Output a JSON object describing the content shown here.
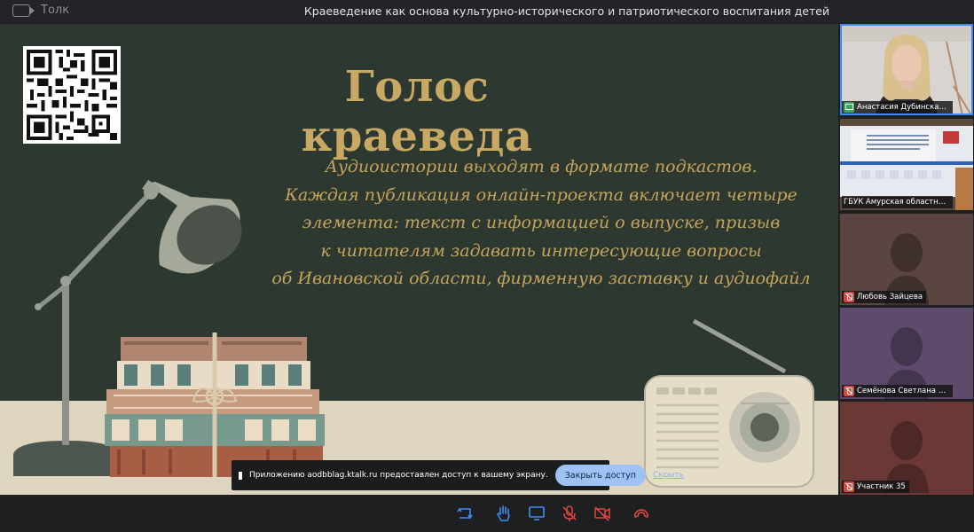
{
  "app": {
    "name": "Толк",
    "meeting_title": "Краеведение как основа культурно-исторического и патриотического воспитания детей"
  },
  "slide": {
    "title": "Голос краеведа",
    "body_lines": [
      "Аудиоистории выходят в формате подкастов.",
      "Каждая публикация онлайн-проекта включает четыре",
      "элемента: текст с информацией о выпуске, призыв",
      "к читателям задавать интересующие вопросы",
      "об Ивановской области, фирменную заставку и аудиофайл"
    ],
    "colors": {
      "background": "#2c3830",
      "title": "#c8a964",
      "floor": "#ddd5bf"
    }
  },
  "screen_share_notice": {
    "text": "Приложению aodbblag.ktalk.ru предоставлен доступ к вашему экрану.",
    "close_access_label": "Закрыть доступ",
    "hide_label": "Скрыть"
  },
  "participants": [
    {
      "name": "Анастасия Дубинская...",
      "indicator": "screen-share-icon",
      "speaking": true
    },
    {
      "name": "ГБУК Амурская областная...",
      "indicator": "none",
      "speaking": false
    },
    {
      "name": "Любовь Зайцева",
      "indicator": "mic-off-icon",
      "speaking": false
    },
    {
      "name": "Семёнова Светлана С...",
      "indicator": "mic-off-icon",
      "speaking": false
    },
    {
      "name": "Участник 35",
      "indicator": "mic-off-icon",
      "speaking": false
    }
  ],
  "toolbar": {
    "buttons": [
      "switch-layout-icon",
      "raise-hand-icon",
      "share-screen-icon",
      "mic-off-icon",
      "camera-off-icon",
      "leave-call-icon"
    ],
    "accent": "#3e8cf3",
    "danger": "#d8463e"
  }
}
